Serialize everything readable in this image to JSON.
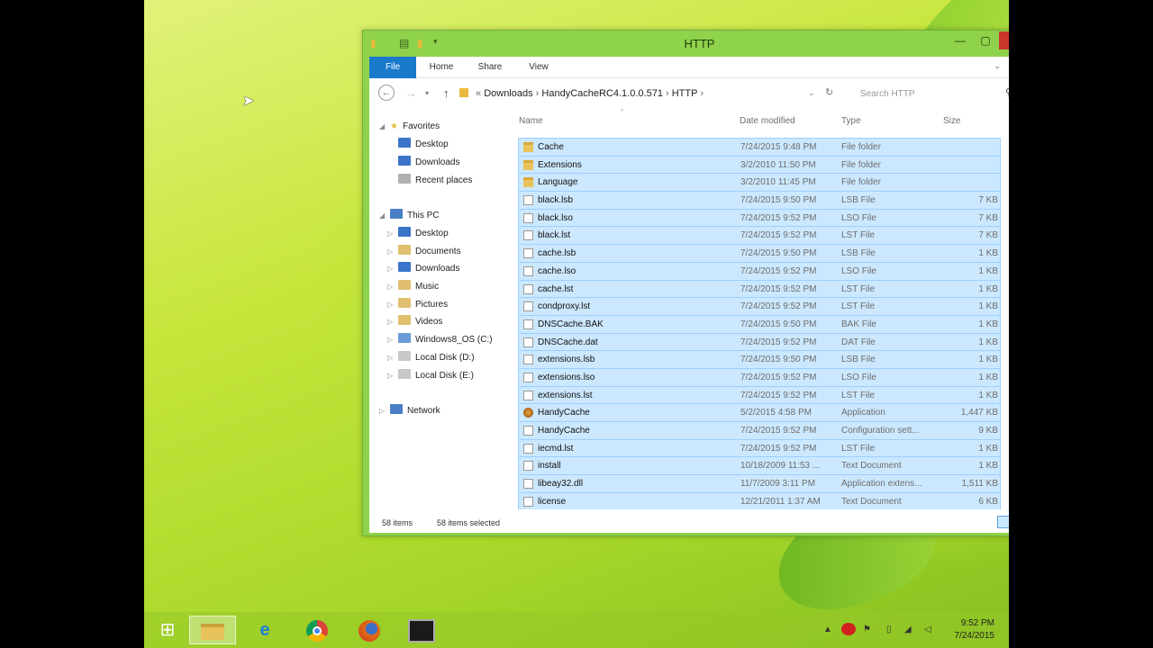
{
  "window": {
    "title": "HTTP"
  },
  "ribbon": {
    "tabs": [
      "File",
      "Home",
      "Share",
      "View"
    ]
  },
  "address": {
    "crumbs": [
      "Downloads",
      "HandyCacheRC4.1.0.0.571",
      "HTTP"
    ],
    "search_placeholder": "Search HTTP"
  },
  "tree": {
    "favorites": {
      "label": "Favorites",
      "items": [
        "Desktop",
        "Downloads",
        "Recent places"
      ]
    },
    "thispc": {
      "label": "This PC",
      "items": [
        "Desktop",
        "Documents",
        "Downloads",
        "Music",
        "Pictures",
        "Videos",
        "Windows8_OS (C:)",
        "Local Disk (D:)",
        "Local Disk (E:)"
      ]
    },
    "network": {
      "label": "Network"
    }
  },
  "columns": {
    "name": "Name",
    "date": "Date modified",
    "type": "Type",
    "size": "Size"
  },
  "files": [
    {
      "name": "Cache",
      "date": "7/24/2015 9:48 PM",
      "type": "File folder",
      "size": "",
      "icon": "folder"
    },
    {
      "name": "Extensions",
      "date": "3/2/2010 11:50 PM",
      "type": "File folder",
      "size": "",
      "icon": "folder"
    },
    {
      "name": "Language",
      "date": "3/2/2010 11:45 PM",
      "type": "File folder",
      "size": "",
      "icon": "folder"
    },
    {
      "name": "black.lsb",
      "date": "7/24/2015 9:50 PM",
      "type": "LSB File",
      "size": "7 KB",
      "icon": "file"
    },
    {
      "name": "black.lso",
      "date": "7/24/2015 9:52 PM",
      "type": "LSO File",
      "size": "7 KB",
      "icon": "file"
    },
    {
      "name": "black.lst",
      "date": "7/24/2015 9:52 PM",
      "type": "LST File",
      "size": "7 KB",
      "icon": "file"
    },
    {
      "name": "cache.lsb",
      "date": "7/24/2015 9:50 PM",
      "type": "LSB File",
      "size": "1 KB",
      "icon": "file"
    },
    {
      "name": "cache.lso",
      "date": "7/24/2015 9:52 PM",
      "type": "LSO File",
      "size": "1 KB",
      "icon": "file"
    },
    {
      "name": "cache.lst",
      "date": "7/24/2015 9:52 PM",
      "type": "LST File",
      "size": "1 KB",
      "icon": "file"
    },
    {
      "name": "condproxy.lst",
      "date": "7/24/2015 9:52 PM",
      "type": "LST File",
      "size": "1 KB",
      "icon": "file"
    },
    {
      "name": "DNSCache.BAK",
      "date": "7/24/2015 9:50 PM",
      "type": "BAK File",
      "size": "1 KB",
      "icon": "file"
    },
    {
      "name": "DNSCache.dat",
      "date": "7/24/2015 9:52 PM",
      "type": "DAT File",
      "size": "1 KB",
      "icon": "file"
    },
    {
      "name": "extensions.lsb",
      "date": "7/24/2015 9:50 PM",
      "type": "LSB File",
      "size": "1 KB",
      "icon": "file"
    },
    {
      "name": "extensions.lso",
      "date": "7/24/2015 9:52 PM",
      "type": "LSO File",
      "size": "1 KB",
      "icon": "file"
    },
    {
      "name": "extensions.lst",
      "date": "7/24/2015 9:52 PM",
      "type": "LST File",
      "size": "1 KB",
      "icon": "file"
    },
    {
      "name": "HandyCache",
      "date": "5/2/2015 4:58 PM",
      "type": "Application",
      "size": "1,447 KB",
      "icon": "app"
    },
    {
      "name": "HandyCache",
      "date": "7/24/2015 9:52 PM",
      "type": "Configuration sett...",
      "size": "9 KB",
      "icon": "file"
    },
    {
      "name": "iecmd.lst",
      "date": "7/24/2015 9:52 PM",
      "type": "LST File",
      "size": "1 KB",
      "icon": "file"
    },
    {
      "name": "install",
      "date": "10/18/2009 11:53 ...",
      "type": "Text Document",
      "size": "1 KB",
      "icon": "file"
    },
    {
      "name": "libeay32.dll",
      "date": "11/7/2009 3:11 PM",
      "type": "Application extens...",
      "size": "1,511 KB",
      "icon": "file"
    },
    {
      "name": "license",
      "date": "12/21/2011 1:37 AM",
      "type": "Text Document",
      "size": "6 KB",
      "icon": "file"
    }
  ],
  "status": {
    "count": "58 items",
    "selected": "58 items selected"
  },
  "clock": {
    "time": "9:52 PM",
    "date": "7/24/2015"
  }
}
